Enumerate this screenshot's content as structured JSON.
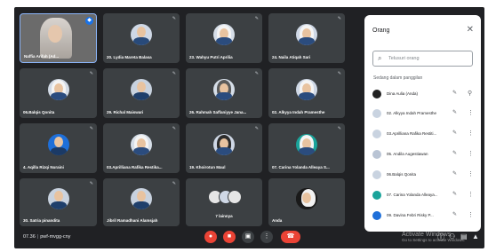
{
  "tiles": [
    {
      "name": "Naffia Arifah (Ad..."
    },
    {
      "name": "20. Lydia Mareta Balasa"
    },
    {
      "name": "23. Wahyu Putri Aprilia"
    },
    {
      "name": "24. Naila Atiqah Sari"
    },
    {
      "name": "06.Balqis Qonita"
    },
    {
      "name": "29. Richal Maiswari"
    },
    {
      "name": "26. Rahmah Saffaniyye Jana..."
    },
    {
      "name": "02. Alkyya Indah Pramesthe"
    },
    {
      "name": "4. Aqilla Rizqi Nuraini"
    },
    {
      "name": "03.Aprilliana Rafika Restika..."
    },
    {
      "name": "19. Khoirotun Maul"
    },
    {
      "name": "07. Carina Yolanda Alleaya S..."
    },
    {
      "name": "30. Satria pinandita"
    },
    {
      "name": "Jibril Ramadhani Alamsjah"
    },
    {
      "name": "7 lainnya"
    },
    {
      "name": "Anda"
    }
  ],
  "panel": {
    "title": "Orang",
    "search_placeholder": "Telusuri orang",
    "section": "Sedang dalam panggilan",
    "people": [
      {
        "name": "Dina Aulia (Anda)"
      },
      {
        "name": "02. Alkyya Indah Pramesthe"
      },
      {
        "name": "03.Aprilliana Rafika Restiti..."
      },
      {
        "name": "05. Andila Augestiawan"
      },
      {
        "name": "06.Balqis Qonita"
      },
      {
        "name": "07. Carina Yolanda Alleaya..."
      },
      {
        "name": "09. Davina Febri Risky P..."
      }
    ]
  },
  "bottom": {
    "time": "07.36",
    "meeting_code": "pwf-mvgg-cny"
  },
  "watermark": {
    "line1": "Activate Windows",
    "line2": "Go to Settings to activate Windows."
  },
  "colors": {
    "accent": "#8ab4f8",
    "end_call": "#ea4335",
    "background": "#202124",
    "tile": "#3c4043"
  }
}
